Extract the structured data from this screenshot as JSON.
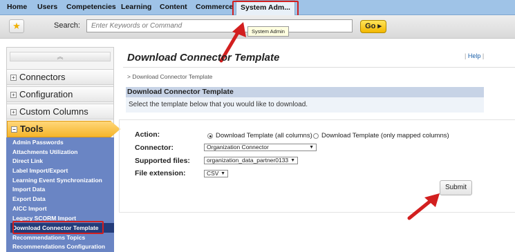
{
  "nav": {
    "items": [
      "Home",
      "Users",
      "Competencies",
      "Learning",
      "Content",
      "Commerce",
      "System Adm..."
    ]
  },
  "search": {
    "label": "Search:",
    "placeholder": "Enter Keywords or Command",
    "go_label": "Go"
  },
  "tooltip": "System Admin",
  "sidebar": {
    "collapse_symbol": "︽",
    "sections": [
      "Connectors",
      "Configuration",
      "Custom Columns"
    ],
    "tools_title": "Tools",
    "tools_items": [
      "Admin Passwords",
      "Attachments Utilization",
      "Direct Link",
      "Label Import/Export",
      "Learning Event Synchronization",
      "Import Data",
      "Export Data",
      "AICC Import",
      "Legacy SCORM Import",
      "Download Connector Template",
      "Recommendations Topics",
      "Recommendations Configuration"
    ]
  },
  "main": {
    "title": "Download Connector Template",
    "help": "Help",
    "breadcrumb": "> Download Connector Template",
    "section_title": "Download Connector Template",
    "instructions": "Select the template below that you would like to download."
  },
  "form": {
    "action_label": "Action:",
    "action_option1": "Download Template (all columns)",
    "action_option2": "Download Template (only mapped columns)",
    "connector_label": "Connector:",
    "connector_value": "Organization Connector",
    "supported_files_label": "Supported files:",
    "supported_files_value": "organization_data_partner0133",
    "file_extension_label": "File extension:",
    "file_extension_value": "CSV",
    "submit_label": "Submit"
  },
  "colors": {
    "highlight": "#d21f1f",
    "nav_bg": "#9fc3e7",
    "tools_bg": "#f5b52a",
    "tool_list_bg": "#6a85c4"
  }
}
